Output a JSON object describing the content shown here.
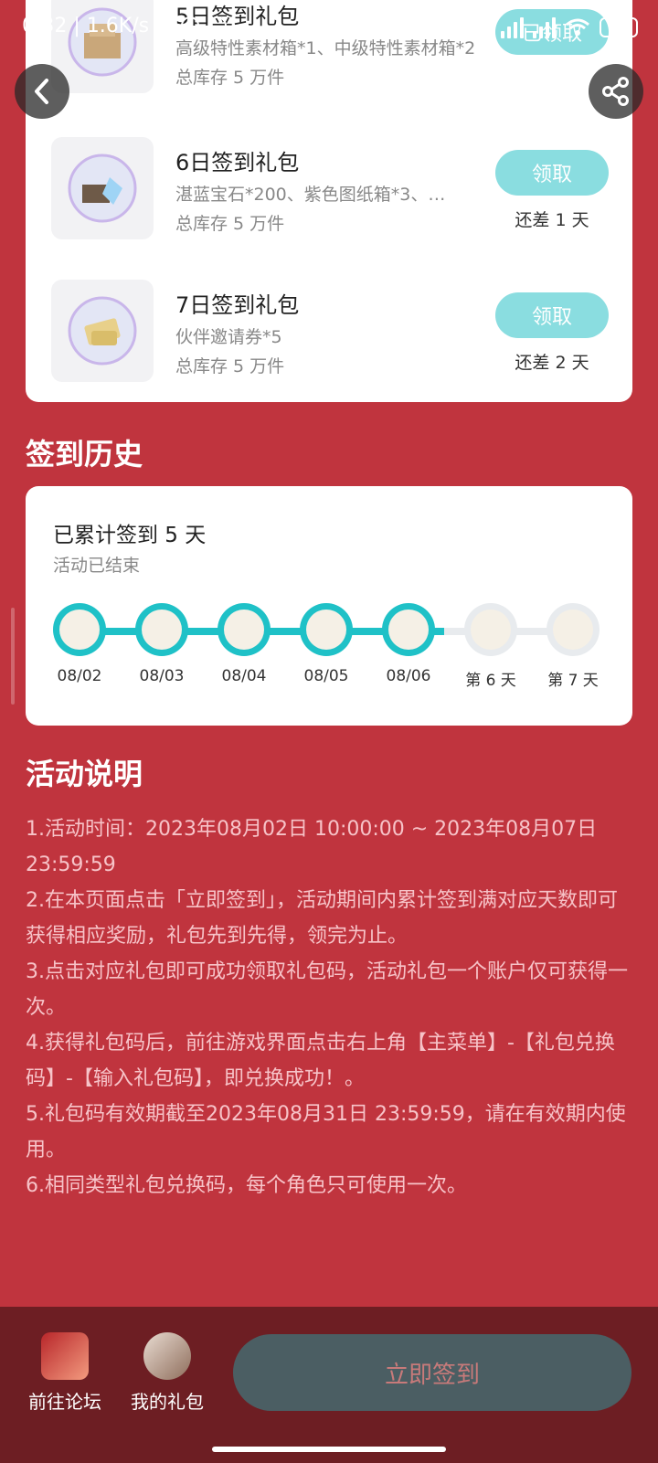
{
  "status_bar": {
    "time": "0:32",
    "speed": "1.6K/s",
    "battery": "82"
  },
  "gifts": [
    {
      "title": "5日签到礼包",
      "desc": "高级特性素材箱*1、中级特性素材箱*2",
      "stock": "总库存 5 万件",
      "button": "已领取",
      "remain": ""
    },
    {
      "title": "6日签到礼包",
      "desc": "湛蓝宝石*200、紫色图纸箱*3、…",
      "stock": "总库存 5 万件",
      "button": "领取",
      "remain": "还差 1 天"
    },
    {
      "title": "7日签到礼包",
      "desc": "伙伴邀请券*5",
      "stock": "总库存 5 万件",
      "button": "领取",
      "remain": "还差 2 天"
    }
  ],
  "history": {
    "section_title": "签到历史",
    "count_text": "已累计签到 5 天",
    "status_text": "活动已结束",
    "days": [
      {
        "label": "08/02",
        "done": true
      },
      {
        "label": "08/03",
        "done": true
      },
      {
        "label": "08/04",
        "done": true
      },
      {
        "label": "08/05",
        "done": true
      },
      {
        "label": "08/06",
        "done": true
      },
      {
        "label": "第 6 天",
        "done": false
      },
      {
        "label": "第 7 天",
        "done": false
      }
    ]
  },
  "rules": {
    "section_title": "活动说明",
    "items": [
      "1.活动时间：2023年08月02日 10:00:00 ~ 2023年08月07日 23:59:59",
      "2.在本页面点击「立即签到」，活动期间内累计签到满对应天数即可获得相应奖励，礼包先到先得，领完为止。",
      "3.点击对应礼包即可成功领取礼包码，活动礼包一个账户仅可获得一次。",
      "4.获得礼包码后，前往游戏界面点击右上角【主菜单】-【礼包兑换码】-【输入礼包码】，即兑换成功！。",
      "5.礼包码有效期截至2023年08月31日 23:59:59，请在有效期内使用。",
      "6.相同类型礼包兑换码，每个角色只可使用一次。"
    ]
  },
  "bottom": {
    "forum_label": "前往论坛",
    "mygift_label": "我的礼包",
    "signin_label": "立即签到"
  },
  "colors": {
    "background": "#c0343e",
    "accent": "#1fc1c7",
    "button": "#8adde0",
    "bottom_bar": "#6d1e23"
  }
}
